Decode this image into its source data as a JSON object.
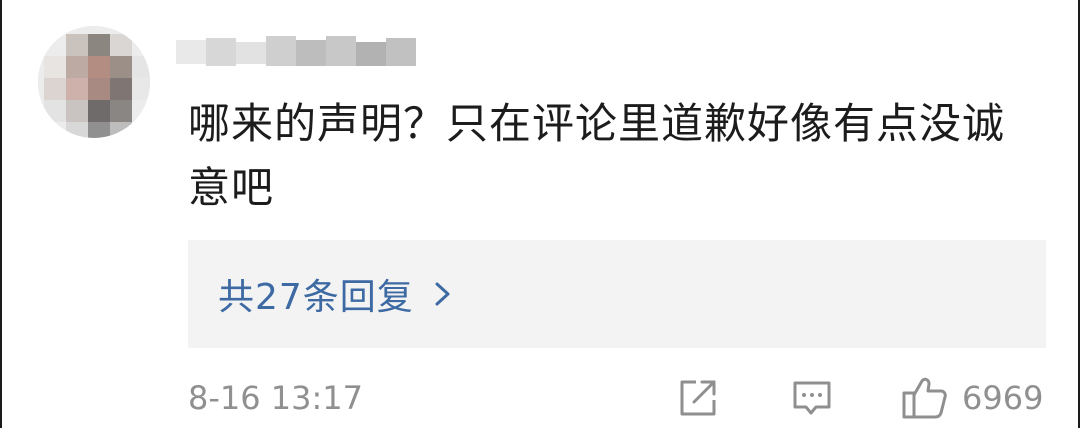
{
  "comment": {
    "text": "哪来的声明？只在评论里道歉好像有点没诚意吧",
    "username_blurred": true
  },
  "replies": {
    "label": "共27条回复",
    "chevron_icon": "chevron-right-icon"
  },
  "footer": {
    "timestamp": "8-16 13:17",
    "like_count": "6969",
    "icons": [
      "share-icon",
      "reply-comment-icon",
      "thumbs-up-icon"
    ]
  },
  "colors": {
    "text": "#1c1c1c",
    "muted": "#909090",
    "link": "#3d6aa3",
    "reply_bg": "#f3f3f3"
  }
}
